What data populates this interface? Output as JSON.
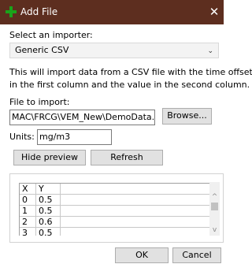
{
  "window": {
    "title": "Add File",
    "close_glyph": "✕"
  },
  "importer": {
    "label": "Select an importer:",
    "selected": "Generic CSV",
    "chevron_glyph": "⌄"
  },
  "description": {
    "line1": "This will import data from a CSV file with the time offset",
    "line2": "in the first column and the value in the second column."
  },
  "file": {
    "label": "File to import:",
    "value": "MAC\\FRCG\\VEM_New\\DemoData.csv",
    "browse_label": "Browse..."
  },
  "units": {
    "label": "Units:",
    "value": "mg/m3"
  },
  "preview": {
    "hide_label": "Hide preview",
    "refresh_label": "Refresh",
    "headers": [
      "X",
      "Y"
    ],
    "rows": [
      [
        "0",
        "0.5"
      ],
      [
        "1",
        "0.5"
      ],
      [
        "2",
        "0.6"
      ],
      [
        "3",
        "0.5"
      ]
    ],
    "scroll_up_glyph": "^",
    "scroll_down_glyph": "v"
  },
  "footer": {
    "ok_label": "OK",
    "cancel_label": "Cancel"
  },
  "colors": {
    "titlebar": "#5d2e1f",
    "add_icon": "#1aa31a"
  }
}
